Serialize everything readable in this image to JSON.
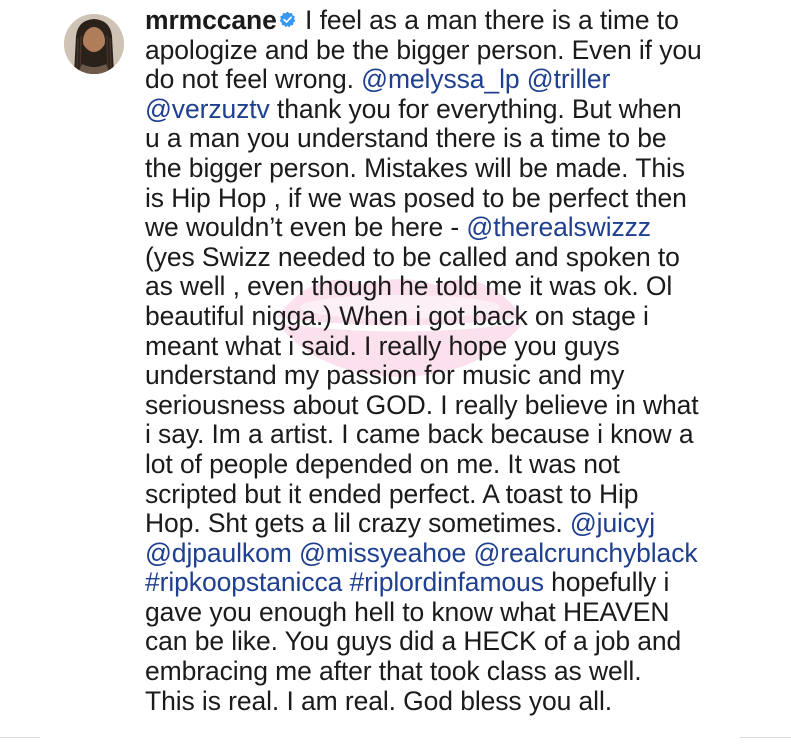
{
  "post": {
    "username": "mrmccane",
    "verified_icon": "verified-badge-icon",
    "avatar_icon": "profile-avatar",
    "watermark_icon": "pink-lips-watermark",
    "colors": {
      "text": "#1b1b1b",
      "link": "#1f3f8f",
      "verified": "#3897f0"
    },
    "caption": {
      "l1": {
        "t1": " I feel as a man there is a time to"
      },
      "l2": {
        "t1": "apologize and be the bigger person. Even if you"
      },
      "l3": {
        "t1": "do not feel wrong. ",
        "m1": "@melyssa_lp",
        "t2": " ",
        "m2": "@triller"
      },
      "l4": {
        "m1": "@verzuztv",
        "t1": " thank you for everything. But when"
      },
      "l5": {
        "t1": "u a man you understand there is a time to be"
      },
      "l6": {
        "t1": "the bigger person. Mistakes will be made. This"
      },
      "l7": {
        "t1": "is Hip Hop , if we was posed to be perfect then"
      },
      "l8": {
        "t1": "we wouldn’t even be here - ",
        "m1": "@therealswizzz"
      },
      "l9": {
        "t1": "(yes Swizz needed to be called and spoken to"
      },
      "l10": {
        "t1": "as well , even though he told me it was ok. Ol"
      },
      "l11": {
        "t1": "beautiful nigga.) When i got back on stage i"
      },
      "l12": {
        "t1": "meant what i said. I really hope you guys"
      },
      "l13": {
        "t1": "understand my passion for music and my"
      },
      "l14": {
        "t1": "seriousness about GOD. I really believe in what"
      },
      "l15": {
        "t1": "i say. Im a artist. I came back because i know a"
      },
      "l16": {
        "t1": "lot of people depended on me. It was not"
      },
      "l17": {
        "t1": "scripted but it ended perfect. A toast to Hip"
      },
      "l18": {
        "t1": "Hop. Sht gets a lil crazy sometimes.  ",
        "m1": "@juicyj"
      },
      "l19": {
        "m1": "@djpaulkom",
        "t1": " ",
        "m2": "@missyeahoe",
        "t2": " ",
        "m3": "@realcrunchyblack"
      },
      "l20": {
        "h1": "#ripkoopstanicca",
        "t1": " ",
        "h2": "#riplordinfamous",
        "t2": " hopefully i"
      },
      "l21": {
        "t1": "gave you enough hell to know what HEAVEN"
      },
      "l22": {
        "t1": "can be like. You guys did a HECK of a job and"
      },
      "l23": {
        "t1": "embracing me after that took class as well."
      },
      "l24": {
        "t1": "This is real. I am real.  God bless you all."
      }
    }
  }
}
